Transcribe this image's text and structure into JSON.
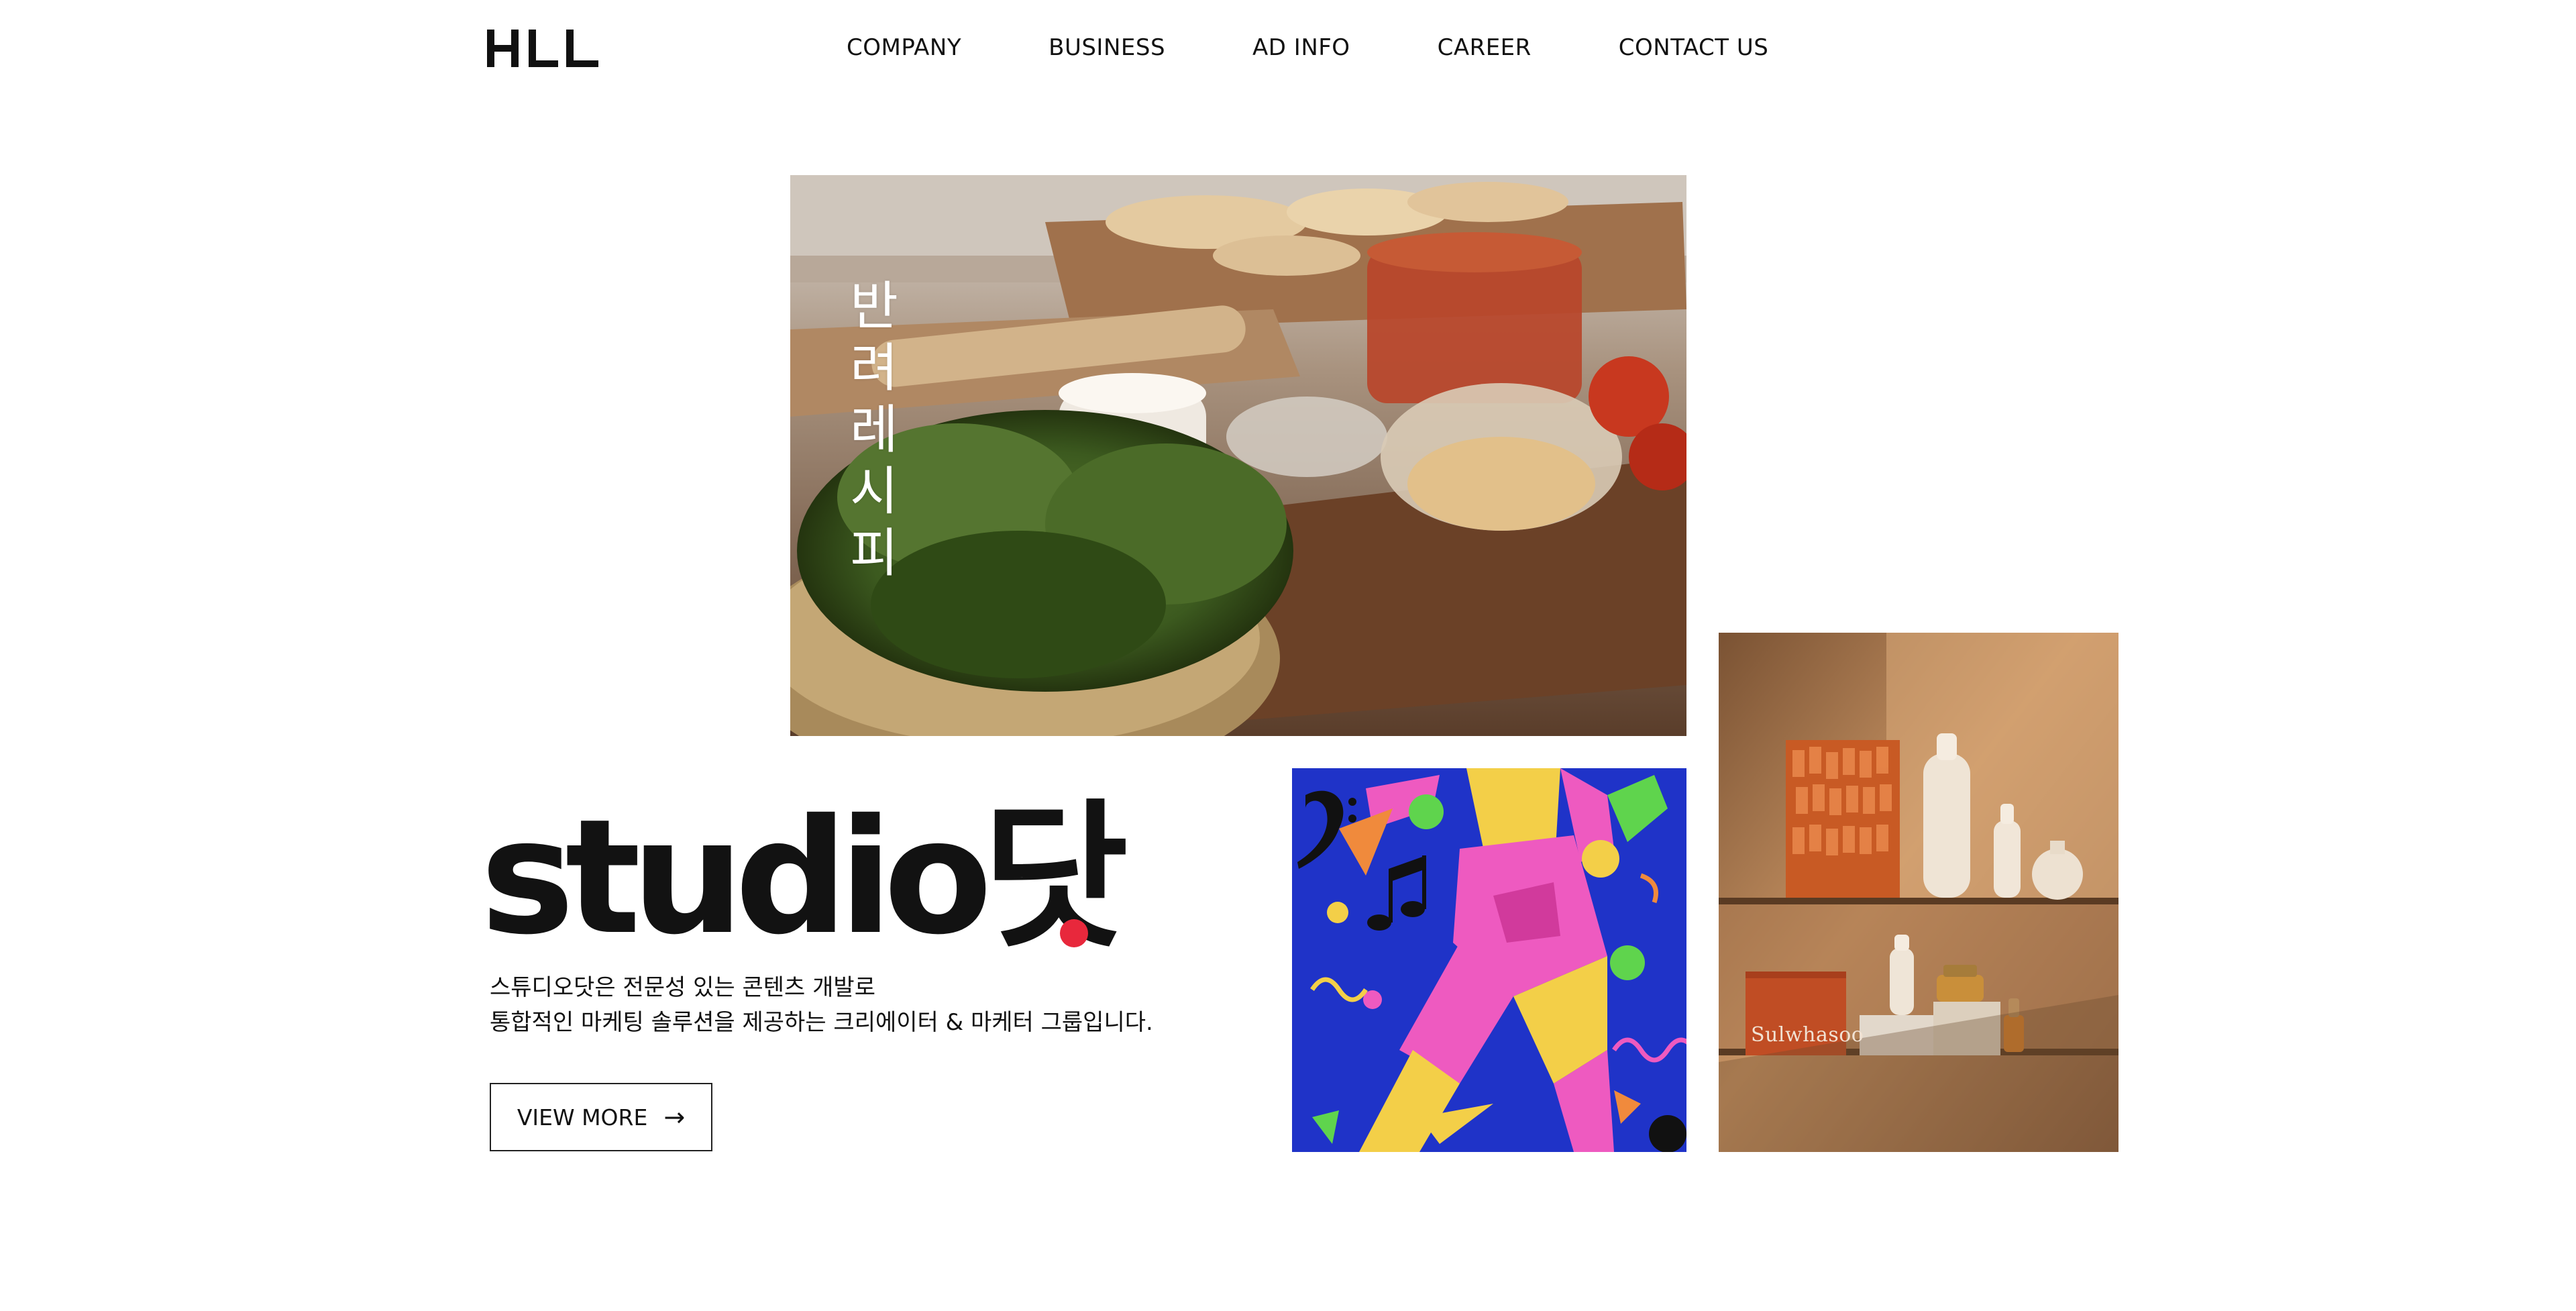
{
  "header": {
    "logo_text": "HLL",
    "nav": [
      "COMPANY",
      "BUSINESS",
      "AD INFO",
      "CAREER",
      "CONTACT US"
    ]
  },
  "hero": {
    "vertical_title": [
      "반",
      "려",
      "레",
      "시",
      "피"
    ],
    "brand": "studio닷",
    "description_lines": [
      "스튜디오닷은 전문성 있는 콘텐츠 개발로",
      "통합적인 마케팅 솔루션을 제공하는 크리에이터 & 마케터 그룹입니다."
    ],
    "cta_label": "VIEW MORE",
    "cta_icon": "arrow-right-icon"
  },
  "cosmetics": {
    "box_text": "Sulwhasoo"
  },
  "colors": {
    "accent": "#e8283c",
    "text": "#111111",
    "art_blue": "#1f33c8",
    "art_pink": "#ee5ac0",
    "art_yellow": "#f3cf48",
    "cos_bg": "#b27f4f"
  }
}
